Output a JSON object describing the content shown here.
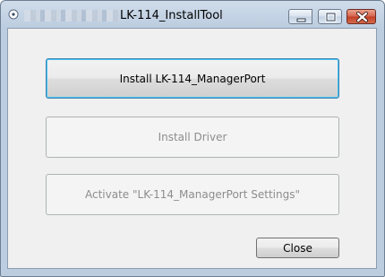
{
  "window": {
    "title": "LK-114_InstallTool"
  },
  "title_controls": {
    "minimize_icon": "minimize-icon",
    "maximize_icon": "maximize-icon",
    "close_icon": "close-icon"
  },
  "buttons": {
    "install_manager_port": "Install LK-114_ManagerPort",
    "install_driver": "Install Driver",
    "activate_settings": "Activate \"LK-114_ManagerPort Settings\"",
    "close": "Close"
  },
  "colors": {
    "focus_border": "#48c5f3",
    "close_control": "#c23f25"
  }
}
